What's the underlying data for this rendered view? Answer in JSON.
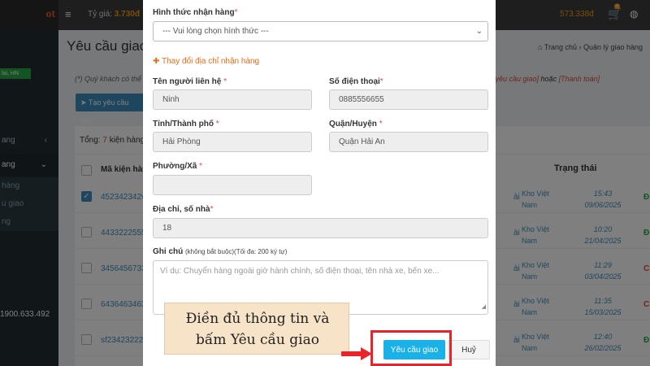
{
  "app": {
    "logo_text": "ot",
    "location_badge": "lai, HN",
    "exchange_label": "Tỷ giá:",
    "exchange_value": "3.730đ",
    "balance": "573.338đ",
    "cart_count": "0",
    "hotline": "1900.633.492",
    "sidebar_items": [
      "ang",
      "ang"
    ],
    "sidebar_subitems": [
      "hàng",
      "u giao",
      "ng"
    ]
  },
  "page": {
    "title": "Yêu cầu giao",
    "breadcrumb_home": "Trang chủ",
    "breadcrumb_current": "Quản lý giao hàng",
    "note_left": "(*) Quý khách có thể",
    "note_right_prefix": "o yêu cầu giao]",
    "note_right_mid": " hoặc ",
    "note_right_link": "[Thanh toán]",
    "create_button": "Tạo yêu cầu giao",
    "total_label": "Tổng: ",
    "total_count": "7",
    "total_suffix": " kiện hàng",
    "col_code": "Mã kiện hàng",
    "col_status": "Trạng thái",
    "rows": [
      {
        "code": "452342342v",
        "ai": "ài",
        "warehouse": "Kho Việt Nam",
        "time": "15:43",
        "date": "09/06/2025",
        "status": "Đ",
        "status_color": "#28a745",
        "checked": true
      },
      {
        "code": "4433222555",
        "ai": "ài",
        "warehouse": "Kho Việt Nam",
        "time": "10:20",
        "date": "21/04/2025",
        "status": "Đ",
        "status_color": "#28a745",
        "checked": false
      },
      {
        "code": "3456456733",
        "ai": "ài",
        "warehouse": "Kho Việt Nam",
        "time": "11:29",
        "date": "03/04/2025",
        "status": "Ch",
        "status_color": "#dd4b39",
        "checked": false
      },
      {
        "code": "6436463463",
        "ai": "ài",
        "warehouse": "Kho Việt Nam",
        "time": "11:35",
        "date": "15/03/2025",
        "status": "Ch",
        "status_color": "#dd4b39",
        "checked": false
      },
      {
        "code": "sf23423222",
        "ai": "ài",
        "warehouse": "Kho Việt Nam",
        "time": "12:40",
        "date": "26/02/2025",
        "status": "Đ",
        "status_color": "#28a745",
        "checked": false
      }
    ]
  },
  "form": {
    "delivery_method_label": "Hình thức nhận hàng",
    "delivery_method_value": "--- Vui lòng chọn hình thức ---",
    "change_address_link": "Thay đổi địa chỉ nhận hàng",
    "contact_name_label": "Tên người liên hệ",
    "contact_name_value": "Ninh",
    "phone_label": "Số điện thoại",
    "phone_value": "0885556655",
    "province_label": "Tỉnh/Thành phố",
    "province_value": "Hải Phòng",
    "district_label": "Quận/Huyện",
    "district_value": "Quận Hải An",
    "ward_label": "Phường/Xã",
    "ward_value": "",
    "address_label": "Địa chỉ, số nhà",
    "address_value": "18",
    "note_label": "Ghi chú",
    "note_hint": "(không bắt buộc)(Tối đa: 200 ký tự)",
    "note_placeholder": "Ví dụ: Chuyển hàng ngoài giờ hành chính, số điện thoại, tên nhà xe, bến xe...",
    "submit_button": "Yêu cầu giao",
    "cancel_button": "Huỷ",
    "required_mark": "*"
  },
  "annotation": {
    "line1": "Điền đủ thông tin và",
    "line2": "bấm Yêu cầu giao"
  },
  "colors": {
    "accent": "#1ab0e8",
    "highlight": "#e8232a",
    "link_orange": "#e86a1b"
  }
}
